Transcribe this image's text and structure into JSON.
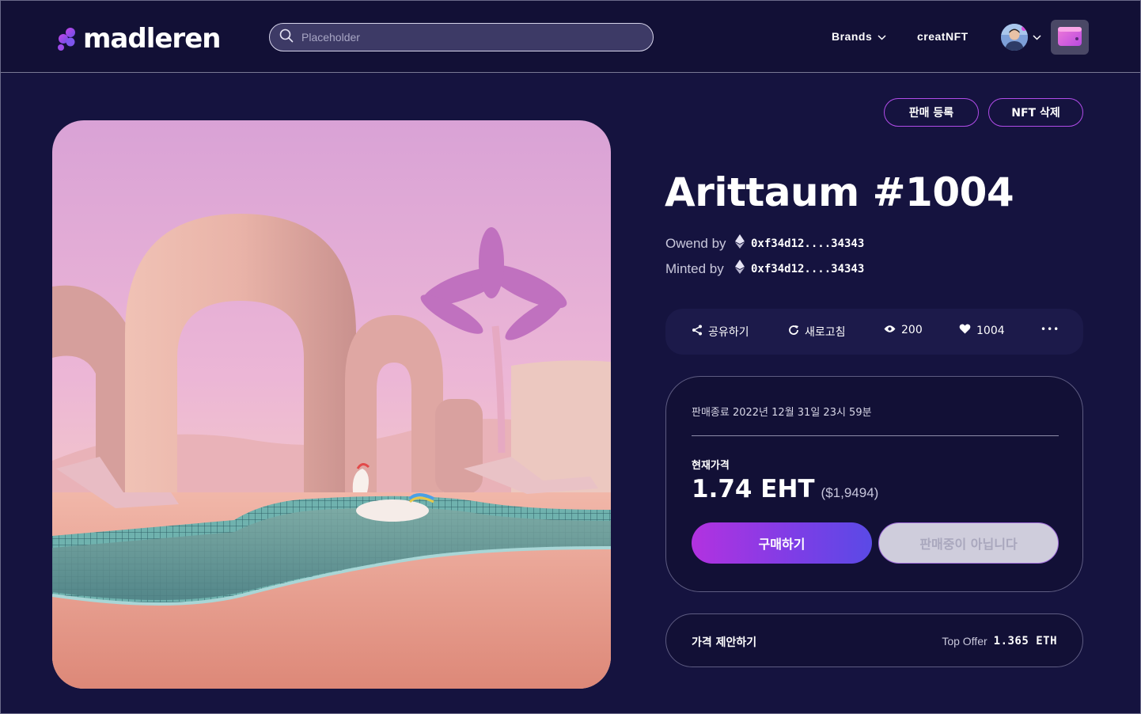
{
  "header": {
    "logo_text": "madleren",
    "search": {
      "placeholder": "Placeholder",
      "value": ""
    },
    "nav": {
      "brands_label": "Brands",
      "create_label": "creatNFT"
    }
  },
  "actions": {
    "list_for_sale": "판매 등록",
    "delete_nft": "NFT 삭제"
  },
  "nft": {
    "title": "Arittaum #1004",
    "owned_label": "Owend by",
    "owned_addr": "0xf34d12....34343",
    "minted_label": "Minted by",
    "minted_addr": "0xf34d12....34343"
  },
  "toolbar": {
    "share": "공유하기",
    "refresh": "새로고침",
    "views": "200",
    "likes": "1004",
    "more": "•••"
  },
  "sale": {
    "end_text": "판매종료 2022년 12월 31일 23시 59분",
    "current_label": "현재가격",
    "price": "1.74 EHT",
    "price_usd": "($1,9494)",
    "buy_label": "구매하기",
    "not_for_sale_label": "판매중이 아닙니다"
  },
  "offer": {
    "label": "가격 제안하기",
    "top_offer_label": "Top Offer",
    "top_offer_value": "1.365 ETH"
  },
  "colors": {
    "background": "#15133f",
    "header_bg": "#121036",
    "accent_purple": "#b04ce8",
    "buy_gradient_start": "#b232e0",
    "buy_gradient_end": "#5a4ae6"
  },
  "icons": {
    "search": "search-icon",
    "brands_chevron": "chevron-down-icon",
    "avatar_chevron": "chevron-down-icon",
    "wallet": "wallet-icon",
    "eth": "ethereum-icon",
    "share": "share-icon",
    "refresh": "refresh-icon",
    "views": "eye-icon",
    "likes": "heart-icon",
    "more": "more-dots-icon"
  }
}
